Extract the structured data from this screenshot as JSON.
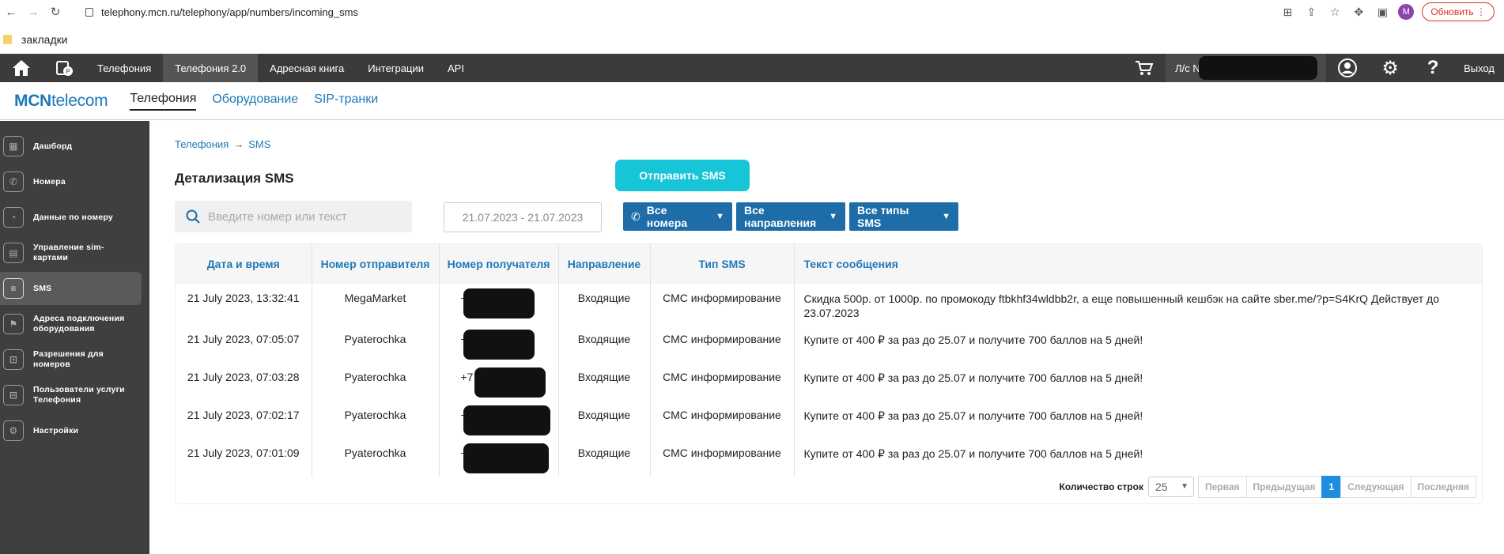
{
  "browser": {
    "url": "telephony.mcn.ru/telephony/app/numbers/incoming_sms",
    "update_label": "Обновить",
    "profile_initial": "M",
    "bookmarks_label": "закладки"
  },
  "topbar": {
    "nav": [
      "Телефония",
      "Телефония 2.0",
      "Адресная книга",
      "Интеграции",
      "API"
    ],
    "account_label": "Л/с N",
    "logout_label": "Выход"
  },
  "subnav": {
    "brand_bold": "MCN",
    "brand_rest": "telecom",
    "tabs": [
      "Телефония",
      "Оборудование",
      "SIP-транки"
    ]
  },
  "sidebar": {
    "items": [
      {
        "label": "Дашборд",
        "icon": "dashboard-icon"
      },
      {
        "label": "Номера",
        "icon": "phone-icon"
      },
      {
        "label": "Данные по номеру",
        "icon": "number-data-icon"
      },
      {
        "label": "Управление sim-картами",
        "icon": "sim-card-icon"
      },
      {
        "label": "SMS",
        "icon": "sms-icon"
      },
      {
        "label": "Адреса подключения оборудования",
        "icon": "address-icon"
      },
      {
        "label": "Разрешения для номеров",
        "icon": "permissions-icon"
      },
      {
        "label": "Пользователи услуги Телефония",
        "icon": "users-icon"
      },
      {
        "label": "Настройки",
        "icon": "settings-icon"
      }
    ]
  },
  "main": {
    "breadcrumb": [
      "Телефония",
      "SMS"
    ],
    "title": "Детализация SMS",
    "send_button": "Отправить SMS",
    "search_placeholder": "Введите номер или текст",
    "date_range": "21.07.2023 - 21.07.2023",
    "filters": {
      "numbers": "Все номера",
      "directions": "Все направления",
      "types": "Все типы SMS"
    },
    "table": {
      "headers": [
        "Дата и время",
        "Номер отправителя",
        "Номер получателя",
        "Направление",
        "Тип SMS",
        "Текст сообщения"
      ],
      "rows": [
        {
          "datetime": "21 July 2023, 13:32:41",
          "sender": "MegaMarket",
          "receiver": "+",
          "direction": "Входящие",
          "type": "СМС информирование",
          "text": "Скидка 500р. от 1000р. по промокоду ftbkhf34wldbb2r, а еще повышенный кешбэк на сайте sber.me/?p=S4KrQ Действует до 23.07.2023"
        },
        {
          "datetime": "21 July 2023, 07:05:07",
          "sender": "Pyaterochka",
          "receiver": "+",
          "direction": "Входящие",
          "type": "СМС информирование",
          "text": "Купите от 400 ₽ за раз до 25.07 и получите 700 баллов на 5 дней!"
        },
        {
          "datetime": "21 July 2023, 07:03:28",
          "sender": "Pyaterochka",
          "receiver": "+7",
          "direction": "Входящие",
          "type": "СМС информирование",
          "text": "Купите от 400 ₽ за раз до 25.07 и получите 700 баллов на 5 дней!"
        },
        {
          "datetime": "21 July 2023, 07:02:17",
          "sender": "Pyaterochka",
          "receiver": "+",
          "direction": "Входящие",
          "type": "СМС информирование",
          "text": "Купите от 400 ₽ за раз до 25.07 и получите 700 баллов на 5 дней!"
        },
        {
          "datetime": "21 July 2023, 07:01:09",
          "sender": "Pyaterochka",
          "receiver": "+",
          "direction": "Входящие",
          "type": "СМС информирование",
          "text": "Купите от 400 ₽ за раз до 25.07 и получите 700 баллов на 5 дней!"
        }
      ]
    },
    "pager": {
      "rows_label": "Количество строк",
      "rows_value": "25",
      "first": "Первая",
      "prev": "Предыдущая",
      "current": "1",
      "next": "Следующая",
      "last": "Последняя"
    }
  },
  "colors": {
    "topbar": "#3b3b3b",
    "sidebar": "#3f3f3f",
    "accent": "#1e79b8",
    "send_button": "#16c5d8",
    "filter_button": "#1e6da8"
  }
}
